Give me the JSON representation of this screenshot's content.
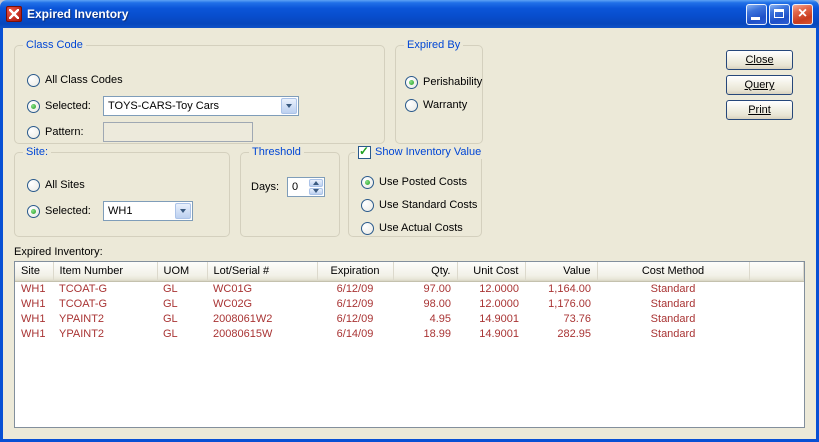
{
  "window": {
    "title": "Expired Inventory"
  },
  "colors": {
    "titlebar_blue": "#0850D4",
    "group_title_blue": "#0046D5",
    "expired_row_red": "#A93434",
    "check_green": "#21A121"
  },
  "groups": {
    "class_code": {
      "title": "Class Code",
      "all_label": "All Class Codes",
      "all_selected": false,
      "selected_label": "Selected:",
      "selected_selected": true,
      "selected_value": "TOYS-CARS-Toy Cars",
      "pattern_label": "Pattern:",
      "pattern_selected": false,
      "pattern_value": ""
    },
    "expired_by": {
      "title": "Expired By",
      "perishability_label": "Perishability",
      "perishability_selected": true,
      "warranty_label": "Warranty",
      "warranty_selected": false
    },
    "site": {
      "title": "Site:",
      "all_label": "All Sites",
      "all_selected": false,
      "selected_label": "Selected:",
      "selected_selected": true,
      "selected_value": "WH1"
    },
    "threshold": {
      "title": "Threshold",
      "days_label": "Days:",
      "days_value": "0"
    },
    "show_value": {
      "title": "Show Inventory Value",
      "checked": true,
      "posted_label": "Use Posted Costs",
      "posted_selected": true,
      "standard_label": "Use Standard Costs",
      "standard_selected": false,
      "actual_label": "Use Actual Costs",
      "actual_selected": false
    }
  },
  "buttons": {
    "close": "Close",
    "query": "Query",
    "print": "Print"
  },
  "table": {
    "label": "Expired Inventory:",
    "columns": [
      "Site",
      "Item Number",
      "UOM",
      "Lot/Serial #",
      "Expiration",
      "Qty.",
      "Unit Cost",
      "Value",
      "Cost Method"
    ],
    "rows": [
      [
        "WH1",
        "TCOAT-G",
        "GL",
        "WC01G",
        "6/12/09",
        "97.00",
        "12.0000",
        "1,164.00",
        "Standard"
      ],
      [
        "WH1",
        "TCOAT-G",
        "GL",
        "WC02G",
        "6/12/09",
        "98.00",
        "12.0000",
        "1,176.00",
        "Standard"
      ],
      [
        "WH1",
        "YPAINT2",
        "GL",
        "2008061W2",
        "6/12/09",
        "4.95",
        "14.9001",
        "73.76",
        "Standard"
      ],
      [
        "WH1",
        "YPAINT2",
        "GL",
        "20080615W",
        "6/14/09",
        "18.99",
        "14.9001",
        "282.95",
        "Standard"
      ]
    ]
  }
}
